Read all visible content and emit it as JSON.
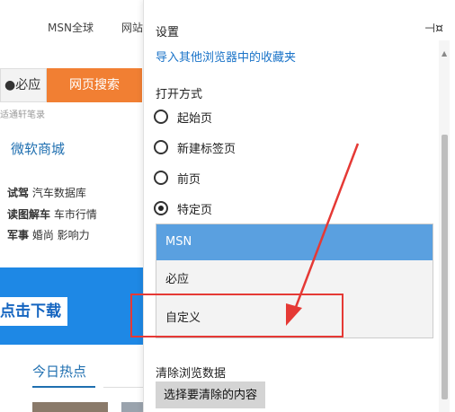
{
  "background_page": {
    "nav": [
      "MSN全球",
      "网站"
    ],
    "search_buttons": [
      "必应",
      "网页搜索"
    ],
    "small_text": "适通轩笔录",
    "store_link": "微软商城",
    "rows": [
      {
        "bold": "试驾",
        "rest": "汽车数据库"
      },
      {
        "bold": "读图解车",
        "rest": "车市行情"
      },
      {
        "bold": "军事",
        "rest": "婚尚  影响力"
      }
    ],
    "banner_button": "点击下载",
    "hot_title": "今日热点"
  },
  "settings": {
    "title": "设置",
    "pin_icon": "pin-icon",
    "import_link": "导入其他浏览器中的收藏夹",
    "open_with_label": "打开方式",
    "radio_options": [
      {
        "label": "起始页",
        "checked": false
      },
      {
        "label": "新建标签页",
        "checked": false
      },
      {
        "label": "前页",
        "checked": false
      },
      {
        "label": "特定页",
        "checked": true
      }
    ],
    "dropdown": {
      "options": [
        "MSN",
        "必应",
        "自定义"
      ],
      "selected": "MSN"
    },
    "clear_data_label": "清除浏览数据",
    "clear_button": "选择要清除的内容"
  },
  "colors": {
    "accent_blue": "#5aa0e0",
    "link_blue": "#1a73c8",
    "search_orange": "#f17f33",
    "annotation_red": "#e53935"
  }
}
